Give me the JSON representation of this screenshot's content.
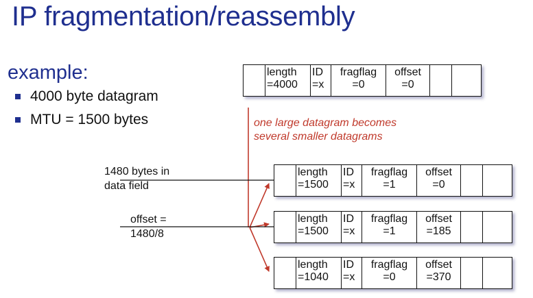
{
  "title": "IP fragmentation/reassembly",
  "subheading": "example:",
  "bullets": [
    "4000 byte datagram",
    "MTU = 1500 bytes"
  ],
  "caption": {
    "line1": "one large datagram becomes",
    "line2": "several smaller datagrams"
  },
  "notes": {
    "data_field": {
      "line1": "1480 bytes in",
      "line2": "data field"
    },
    "offset_calc": {
      "line1": "offset =",
      "line2": "1480/8"
    }
  },
  "original_datagram": {
    "length_label": "length",
    "length_value": "=4000",
    "id_label": "ID",
    "id_value": "=x",
    "fragflag_label": "fragflag",
    "fragflag_value": "=0",
    "offset_label": "offset",
    "offset_value": "=0"
  },
  "fragments": [
    {
      "length_label": "length",
      "length_value": "=1500",
      "id_label": "ID",
      "id_value": "=x",
      "fragflag_label": "fragflag",
      "fragflag_value": "=1",
      "offset_label": "offset",
      "offset_value": "=0"
    },
    {
      "length_label": "length",
      "length_value": "=1500",
      "id_label": "ID",
      "id_value": "=x",
      "fragflag_label": "fragflag",
      "fragflag_value": "=1",
      "offset_label": "offset",
      "offset_value": "=185"
    },
    {
      "length_label": "length",
      "length_value": "=1040",
      "id_label": "ID",
      "id_value": "=x",
      "fragflag_label": "fragflag",
      "fragflag_value": "=0",
      "offset_label": "offset",
      "offset_value": "=370"
    }
  ],
  "colors": {
    "title": "#1f2f8f",
    "caption": "#c0392b",
    "arrow": "#c0392b"
  }
}
